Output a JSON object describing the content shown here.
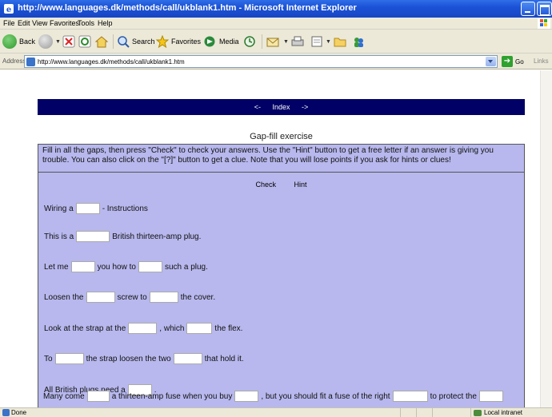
{
  "window": {
    "title": "http://www.languages.dk/methods/call/ukblank1.htm - Microsoft Internet Explorer"
  },
  "menu": {
    "items": [
      "File",
      "Edit",
      "View",
      "Favorites",
      "Tools",
      "Help"
    ]
  },
  "toolbar": {
    "back_label": "Back",
    "search_label": "Search",
    "favorites_label": "Favorites",
    "media_label": "Media"
  },
  "address": {
    "label": "Address",
    "url": "http://www.languages.dk/methods/call/ukblank1.htm",
    "go_label": "Go",
    "links_label": "Links"
  },
  "page": {
    "nav": {
      "prev": "<-",
      "index": "Index",
      "next": "->"
    },
    "heading": "Gap-fill exercise",
    "instructions": "Fill in all the gaps, then press \"Check\" to check your answers. Use the \"Hint\" button to get a free letter if an answer is giving you trouble. You can also click on the \"[?]\" button to get a clue. Note that you will lose points if you ask for hints or clues!",
    "check_label": "Check",
    "hint_label": "Hint",
    "lines": [
      [
        "Wiring a",
        "- Instructions"
      ],
      [
        "This is a",
        "British thirteen-amp plug."
      ],
      [
        "Let me",
        "you how to",
        "such a plug."
      ],
      [
        "Loosen the",
        "screw to",
        "the cover."
      ],
      [
        "Look at the strap at the",
        ", which",
        "the flex."
      ],
      [
        "To",
        "the strap loosen the two",
        "that hold it."
      ],
      [
        "All British plugs need a",
        "."
      ],
      [
        "Many come",
        "a thirteen-amp fuse when you buy",
        ", but you should fit a fuse of the right",
        "to protect the"
      ]
    ]
  },
  "status": {
    "text": "Done",
    "zone": "Local intranet"
  },
  "colors": {
    "titlebar": "#1b52d6",
    "nav_bg": "#000066",
    "panel_bg": "#b8b8ee"
  }
}
